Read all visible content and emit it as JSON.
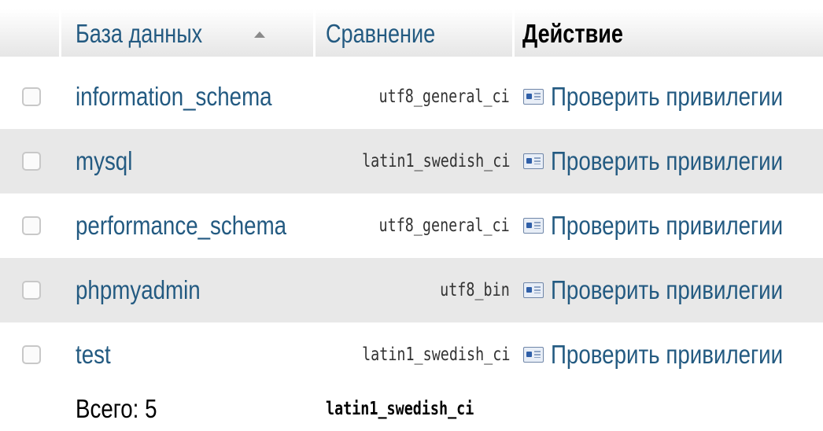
{
  "header": {
    "database_label": "База данных",
    "collation_label": "Сравнение",
    "action_label": "Действие"
  },
  "rows": [
    {
      "name": "information_schema",
      "collation": "utf8_general_ci",
      "action": "Проверить привилегии"
    },
    {
      "name": "mysql",
      "collation": "latin1_swedish_ci",
      "action": "Проверить привилегии"
    },
    {
      "name": "performance_schema",
      "collation": "utf8_general_ci",
      "action": "Проверить привилегии"
    },
    {
      "name": "phpmyadmin",
      "collation": "utf8_bin",
      "action": "Проверить привилегии"
    },
    {
      "name": "test",
      "collation": "latin1_swedish_ci",
      "action": "Проверить привилегии"
    }
  ],
  "footer": {
    "total_label": "Всего: 5",
    "collation": "latin1_swedish_ci"
  },
  "icons": {
    "sort": "sort-ascending-icon",
    "privileges": "privileges-icon"
  },
  "colors": {
    "link": "#235a81",
    "alt_row": "#e8e8e8"
  }
}
